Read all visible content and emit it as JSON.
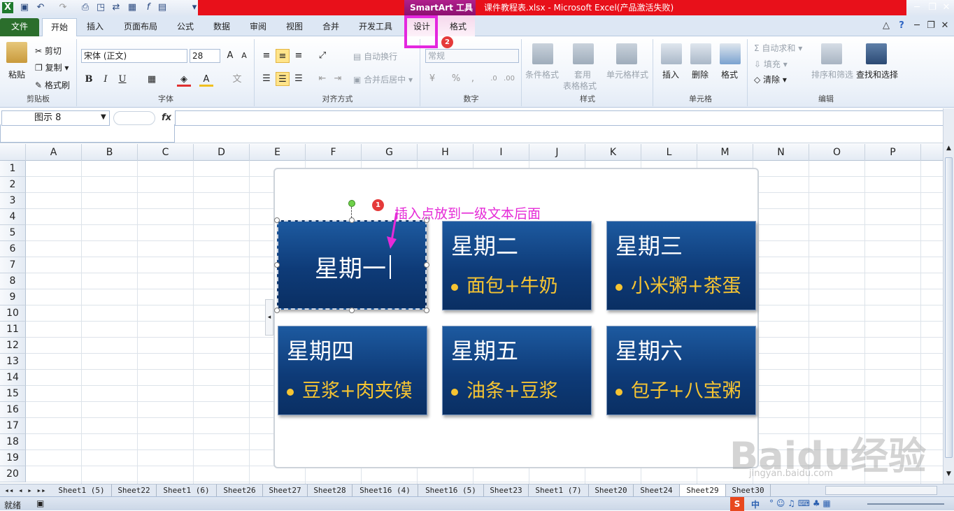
{
  "window": {
    "context_tool": "SmartArt 工具",
    "title": "课件教程表.xlsx  -  Microsoft Excel(产品激活失败)"
  },
  "tabs": [
    "文件",
    "开始",
    "插入",
    "页面布局",
    "公式",
    "数据",
    "审阅",
    "视图",
    "合并",
    "开发工具",
    "设计",
    "格式"
  ],
  "ribbon": {
    "clipboard": {
      "label": "剪贴板",
      "paste": "粘贴",
      "cut": "剪切",
      "copy": "复制",
      "format_painter": "格式刷"
    },
    "font": {
      "label": "字体",
      "name": "宋体 (正文)",
      "size": "28",
      "bold": "B",
      "italic": "I",
      "underline": "U"
    },
    "alignment": {
      "label": "对齐方式",
      "wrap": "自动换行",
      "merge": "合并后居中"
    },
    "number": {
      "label": "数字",
      "format": "常规",
      "percent": "%",
      "comma": ","
    },
    "styles": {
      "label": "样式",
      "cond_format": "条件格式",
      "table_format_l1": "套用",
      "table_format_l2": "表格格式",
      "cell_styles": "单元格样式"
    },
    "cells": {
      "label": "单元格",
      "insert": "插入",
      "delete": "删除",
      "format": "格式"
    },
    "editing": {
      "label": "编辑",
      "autosum": "自动求和",
      "fill": "填充",
      "clear": "清除",
      "sort": "排序和筛选",
      "find": "查找和选择"
    }
  },
  "formula_bar": {
    "name_box": "图示 8",
    "fx": "fx",
    "value": ""
  },
  "columns": [
    "A",
    "B",
    "C",
    "D",
    "E",
    "F",
    "G",
    "H",
    "I",
    "J",
    "K",
    "L",
    "M",
    "N",
    "O",
    "P"
  ],
  "rows": [
    "1",
    "2",
    "3",
    "4",
    "5",
    "6",
    "7",
    "8",
    "9",
    "10",
    "11",
    "12",
    "13",
    "14",
    "15",
    "16",
    "17",
    "18",
    "19",
    "20"
  ],
  "smartart": {
    "items": [
      {
        "title": "星期一",
        "bullet": ""
      },
      {
        "title": "星期二",
        "bullet": "面包+牛奶"
      },
      {
        "title": "星期三",
        "bullet": "小米粥+茶蛋"
      },
      {
        "title": "星期四",
        "bullet": "豆浆+肉夹馍"
      },
      {
        "title": "星期五",
        "bullet": "油条+豆浆"
      },
      {
        "title": "星期六",
        "bullet": "包子+八宝粥"
      }
    ],
    "box_color": "#0e3b78",
    "bullet_color": "#f6c432"
  },
  "annotation": {
    "badge1": "1",
    "badge2": "2",
    "text": "插入点放到一级文本后面",
    "color": "#e52ad7"
  },
  "sheets": [
    "Sheet1 (5)",
    "Sheet22",
    "Sheet1 (6)",
    "Sheet26",
    "Sheet27",
    "Sheet28",
    "Sheet16 (4)",
    "Sheet16 (5)",
    "Sheet23",
    "Sheet1 (7)",
    "Sheet20",
    "Sheet24",
    "Sheet29",
    "Sheet30"
  ],
  "active_sheet": "Sheet29",
  "status": {
    "ready": "就绪",
    "ime": "中"
  },
  "watermark": {
    "brand": "Baidu经验",
    "url": "jingyan.baidu.com"
  }
}
